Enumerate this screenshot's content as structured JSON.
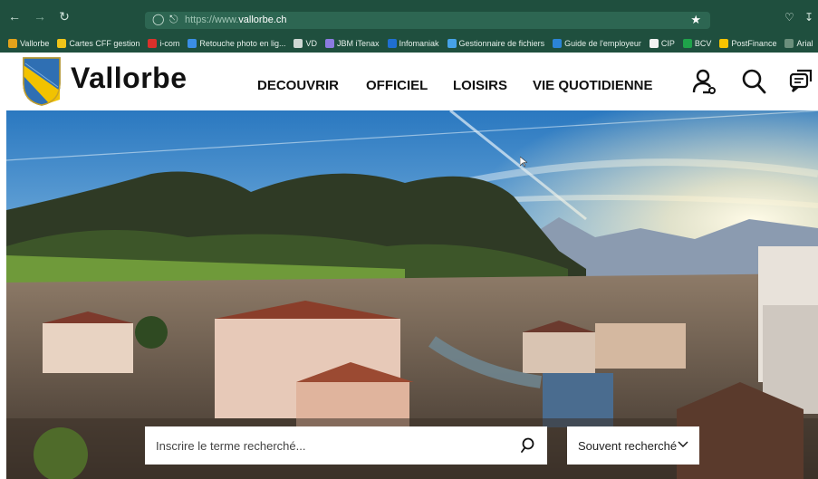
{
  "browser": {
    "url_prefix": "https://www.",
    "url_domain": "vallorbe.ch",
    "bookmarks": [
      {
        "label": "Vallorbe",
        "color": "#e2a21a"
      },
      {
        "label": "Cartes CFF gestion",
        "color": "#f0c419"
      },
      {
        "label": "i-com",
        "color": "#d9312b"
      },
      {
        "label": "Retouche photo en lig...",
        "color": "#3a8ee6"
      },
      {
        "label": "VD",
        "color": "#cfd8d4"
      },
      {
        "label": "JBM iTenax",
        "color": "#8b7be0"
      },
      {
        "label": "Infomaniak",
        "color": "#1f6fd1"
      },
      {
        "label": "Gestionnaire de fichiers",
        "color": "#46a2e8"
      },
      {
        "label": "Guide de l'employeur",
        "color": "#2b84d6"
      },
      {
        "label": "CIP",
        "color": "#f2f2f2"
      },
      {
        "label": "BCV",
        "color": "#1fa34a"
      },
      {
        "label": "PostFinance",
        "color": "#f6c400"
      },
      {
        "label": "Arial",
        "color": "#6b8f7c"
      }
    ],
    "icons": [
      "back-icon",
      "forward-icon",
      "reload-icon",
      "shield-icon",
      "lock-icon",
      "star-icon",
      "pocket-icon",
      "download-icon"
    ]
  },
  "site": {
    "name": "Vallorbe",
    "menu": [
      "DECOUVRIR",
      "OFFICIEL",
      "LOISIRS",
      "VIE QUOTIDIENNE"
    ],
    "header_icons": [
      "account-icon",
      "search-icon",
      "chat-icon"
    ]
  },
  "search": {
    "placeholder": "Inscrire le terme recherché...",
    "popular_label": "Souvent recherché"
  },
  "colors": {
    "browser_bar": "#1f4f3e",
    "crest_blue": "#2f6fb3",
    "crest_yellow": "#f2c200"
  }
}
